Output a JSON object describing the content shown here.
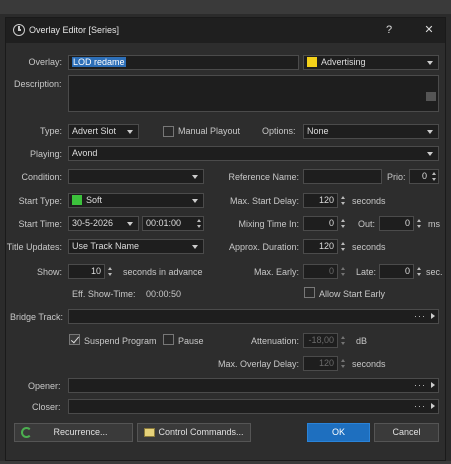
{
  "window": {
    "title": "Overlay Editor [Series]",
    "help_label": "?",
    "close_label": "✕"
  },
  "colors": {
    "accent": "#1e6fbf",
    "advertising": "#f4d11a",
    "start_type": "#3cc23c"
  },
  "overlay": {
    "label": "Overlay:",
    "value": "LOD redame",
    "category": "Advertising"
  },
  "description": {
    "label": "Description:"
  },
  "type": {
    "label": "Type:",
    "value": "Advert Slot"
  },
  "manual_playout": {
    "label": "Manual Playout",
    "checked": false
  },
  "options": {
    "label": "Options:",
    "value": "None"
  },
  "playing": {
    "label": "Playing:",
    "value": "Avond"
  },
  "condition": {
    "label": "Condition:",
    "value": ""
  },
  "reference_name": {
    "label": "Reference Name:",
    "value": ""
  },
  "prio": {
    "label": "Prio:",
    "value": "0"
  },
  "start_type": {
    "label": "Start Type:",
    "value": "Soft"
  },
  "max_start_delay": {
    "label": "Max. Start Delay:",
    "value": "120",
    "unit": "seconds"
  },
  "start_time": {
    "label": "Start Time:",
    "date": "30-5-2026",
    "time": "00:01:00"
  },
  "mixing_time_in": {
    "label": "Mixing Time In:",
    "value": "0"
  },
  "out": {
    "label": "Out:",
    "value": "0",
    "unit": "ms"
  },
  "title_updates": {
    "label": "Title Updates:",
    "value": "Use Track Name"
  },
  "approx_duration": {
    "label": "Approx. Duration:",
    "value": "120",
    "unit": "seconds"
  },
  "show": {
    "label": "Show:",
    "value": "10",
    "unit": "seconds in advance"
  },
  "max_early": {
    "label": "Max. Early:",
    "value": "0"
  },
  "late": {
    "label": "Late:",
    "value": "0",
    "unit": "sec."
  },
  "eff_show_time": {
    "label": "Eff. Show-Time:",
    "value": "00:00:50"
  },
  "allow_start_early": {
    "label": "Allow Start Early",
    "checked": false
  },
  "bridge_track": {
    "label": "Bridge Track:",
    "dots": "···"
  },
  "suspend_program": {
    "label": "Suspend Program",
    "checked": true
  },
  "pause": {
    "label": "Pause",
    "checked": false
  },
  "attenuation": {
    "label": "Attenuation:",
    "value": "-18,00",
    "unit": "dB"
  },
  "max_overlay_delay": {
    "label": "Max. Overlay Delay:",
    "value": "120",
    "unit": "seconds"
  },
  "opener": {
    "label": "Opener:",
    "dots": "···"
  },
  "closer": {
    "label": "Closer:",
    "dots": "···"
  },
  "buttons": {
    "recurrence": "Recurrence...",
    "control_commands": "Control Commands...",
    "ok": "OK",
    "cancel": "Cancel"
  }
}
